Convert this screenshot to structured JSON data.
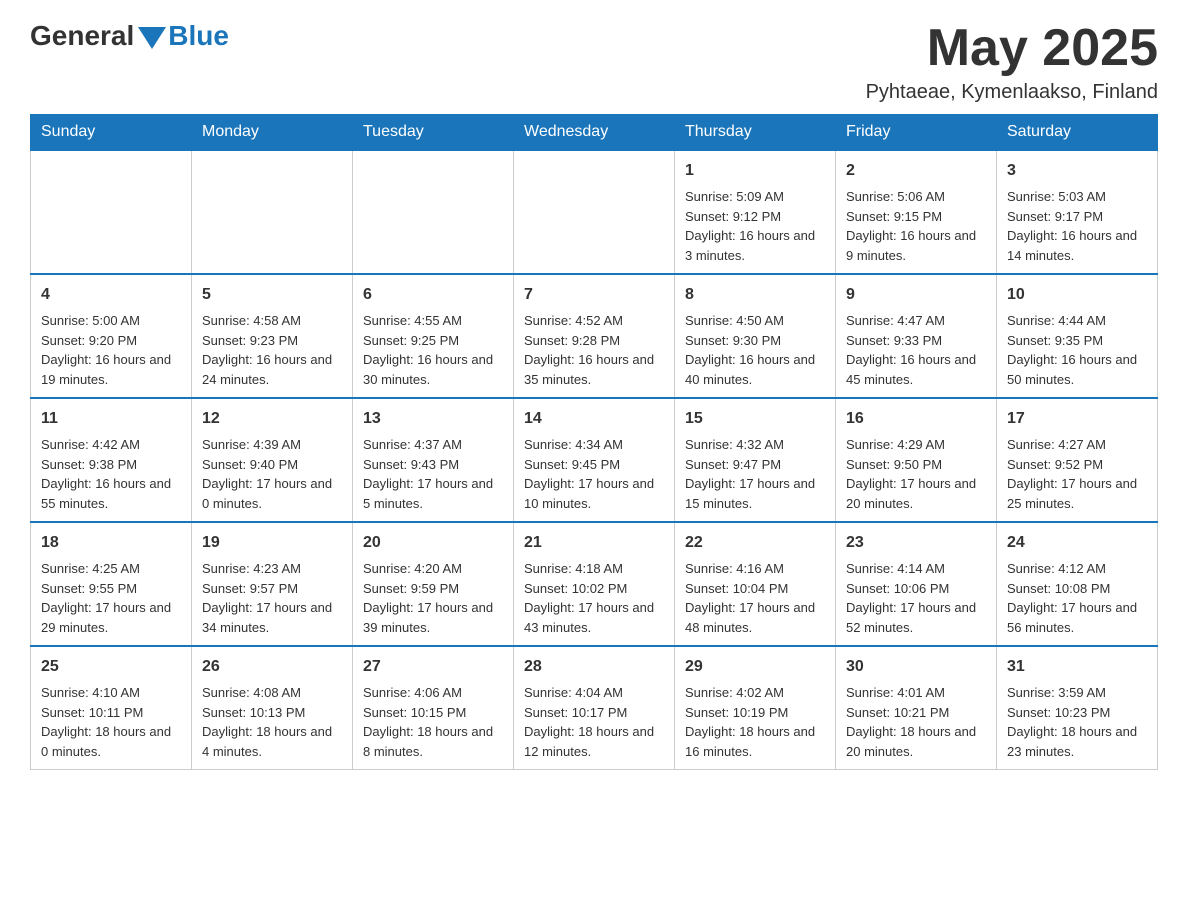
{
  "header": {
    "logo": {
      "general": "General",
      "blue": "Blue"
    },
    "title": "May 2025",
    "location": "Pyhtaeae, Kymenlaakso, Finland"
  },
  "days_of_week": [
    "Sunday",
    "Monday",
    "Tuesday",
    "Wednesday",
    "Thursday",
    "Friday",
    "Saturday"
  ],
  "weeks": [
    [
      {
        "day": "",
        "info": ""
      },
      {
        "day": "",
        "info": ""
      },
      {
        "day": "",
        "info": ""
      },
      {
        "day": "",
        "info": ""
      },
      {
        "day": "1",
        "info": "Sunrise: 5:09 AM\nSunset: 9:12 PM\nDaylight: 16 hours and 3 minutes."
      },
      {
        "day": "2",
        "info": "Sunrise: 5:06 AM\nSunset: 9:15 PM\nDaylight: 16 hours and 9 minutes."
      },
      {
        "day": "3",
        "info": "Sunrise: 5:03 AM\nSunset: 9:17 PM\nDaylight: 16 hours and 14 minutes."
      }
    ],
    [
      {
        "day": "4",
        "info": "Sunrise: 5:00 AM\nSunset: 9:20 PM\nDaylight: 16 hours and 19 minutes."
      },
      {
        "day": "5",
        "info": "Sunrise: 4:58 AM\nSunset: 9:23 PM\nDaylight: 16 hours and 24 minutes."
      },
      {
        "day": "6",
        "info": "Sunrise: 4:55 AM\nSunset: 9:25 PM\nDaylight: 16 hours and 30 minutes."
      },
      {
        "day": "7",
        "info": "Sunrise: 4:52 AM\nSunset: 9:28 PM\nDaylight: 16 hours and 35 minutes."
      },
      {
        "day": "8",
        "info": "Sunrise: 4:50 AM\nSunset: 9:30 PM\nDaylight: 16 hours and 40 minutes."
      },
      {
        "day": "9",
        "info": "Sunrise: 4:47 AM\nSunset: 9:33 PM\nDaylight: 16 hours and 45 minutes."
      },
      {
        "day": "10",
        "info": "Sunrise: 4:44 AM\nSunset: 9:35 PM\nDaylight: 16 hours and 50 minutes."
      }
    ],
    [
      {
        "day": "11",
        "info": "Sunrise: 4:42 AM\nSunset: 9:38 PM\nDaylight: 16 hours and 55 minutes."
      },
      {
        "day": "12",
        "info": "Sunrise: 4:39 AM\nSunset: 9:40 PM\nDaylight: 17 hours and 0 minutes."
      },
      {
        "day": "13",
        "info": "Sunrise: 4:37 AM\nSunset: 9:43 PM\nDaylight: 17 hours and 5 minutes."
      },
      {
        "day": "14",
        "info": "Sunrise: 4:34 AM\nSunset: 9:45 PM\nDaylight: 17 hours and 10 minutes."
      },
      {
        "day": "15",
        "info": "Sunrise: 4:32 AM\nSunset: 9:47 PM\nDaylight: 17 hours and 15 minutes."
      },
      {
        "day": "16",
        "info": "Sunrise: 4:29 AM\nSunset: 9:50 PM\nDaylight: 17 hours and 20 minutes."
      },
      {
        "day": "17",
        "info": "Sunrise: 4:27 AM\nSunset: 9:52 PM\nDaylight: 17 hours and 25 minutes."
      }
    ],
    [
      {
        "day": "18",
        "info": "Sunrise: 4:25 AM\nSunset: 9:55 PM\nDaylight: 17 hours and 29 minutes."
      },
      {
        "day": "19",
        "info": "Sunrise: 4:23 AM\nSunset: 9:57 PM\nDaylight: 17 hours and 34 minutes."
      },
      {
        "day": "20",
        "info": "Sunrise: 4:20 AM\nSunset: 9:59 PM\nDaylight: 17 hours and 39 minutes."
      },
      {
        "day": "21",
        "info": "Sunrise: 4:18 AM\nSunset: 10:02 PM\nDaylight: 17 hours and 43 minutes."
      },
      {
        "day": "22",
        "info": "Sunrise: 4:16 AM\nSunset: 10:04 PM\nDaylight: 17 hours and 48 minutes."
      },
      {
        "day": "23",
        "info": "Sunrise: 4:14 AM\nSunset: 10:06 PM\nDaylight: 17 hours and 52 minutes."
      },
      {
        "day": "24",
        "info": "Sunrise: 4:12 AM\nSunset: 10:08 PM\nDaylight: 17 hours and 56 minutes."
      }
    ],
    [
      {
        "day": "25",
        "info": "Sunrise: 4:10 AM\nSunset: 10:11 PM\nDaylight: 18 hours and 0 minutes."
      },
      {
        "day": "26",
        "info": "Sunrise: 4:08 AM\nSunset: 10:13 PM\nDaylight: 18 hours and 4 minutes."
      },
      {
        "day": "27",
        "info": "Sunrise: 4:06 AM\nSunset: 10:15 PM\nDaylight: 18 hours and 8 minutes."
      },
      {
        "day": "28",
        "info": "Sunrise: 4:04 AM\nSunset: 10:17 PM\nDaylight: 18 hours and 12 minutes."
      },
      {
        "day": "29",
        "info": "Sunrise: 4:02 AM\nSunset: 10:19 PM\nDaylight: 18 hours and 16 minutes."
      },
      {
        "day": "30",
        "info": "Sunrise: 4:01 AM\nSunset: 10:21 PM\nDaylight: 18 hours and 20 minutes."
      },
      {
        "day": "31",
        "info": "Sunrise: 3:59 AM\nSunset: 10:23 PM\nDaylight: 18 hours and 23 minutes."
      }
    ]
  ]
}
